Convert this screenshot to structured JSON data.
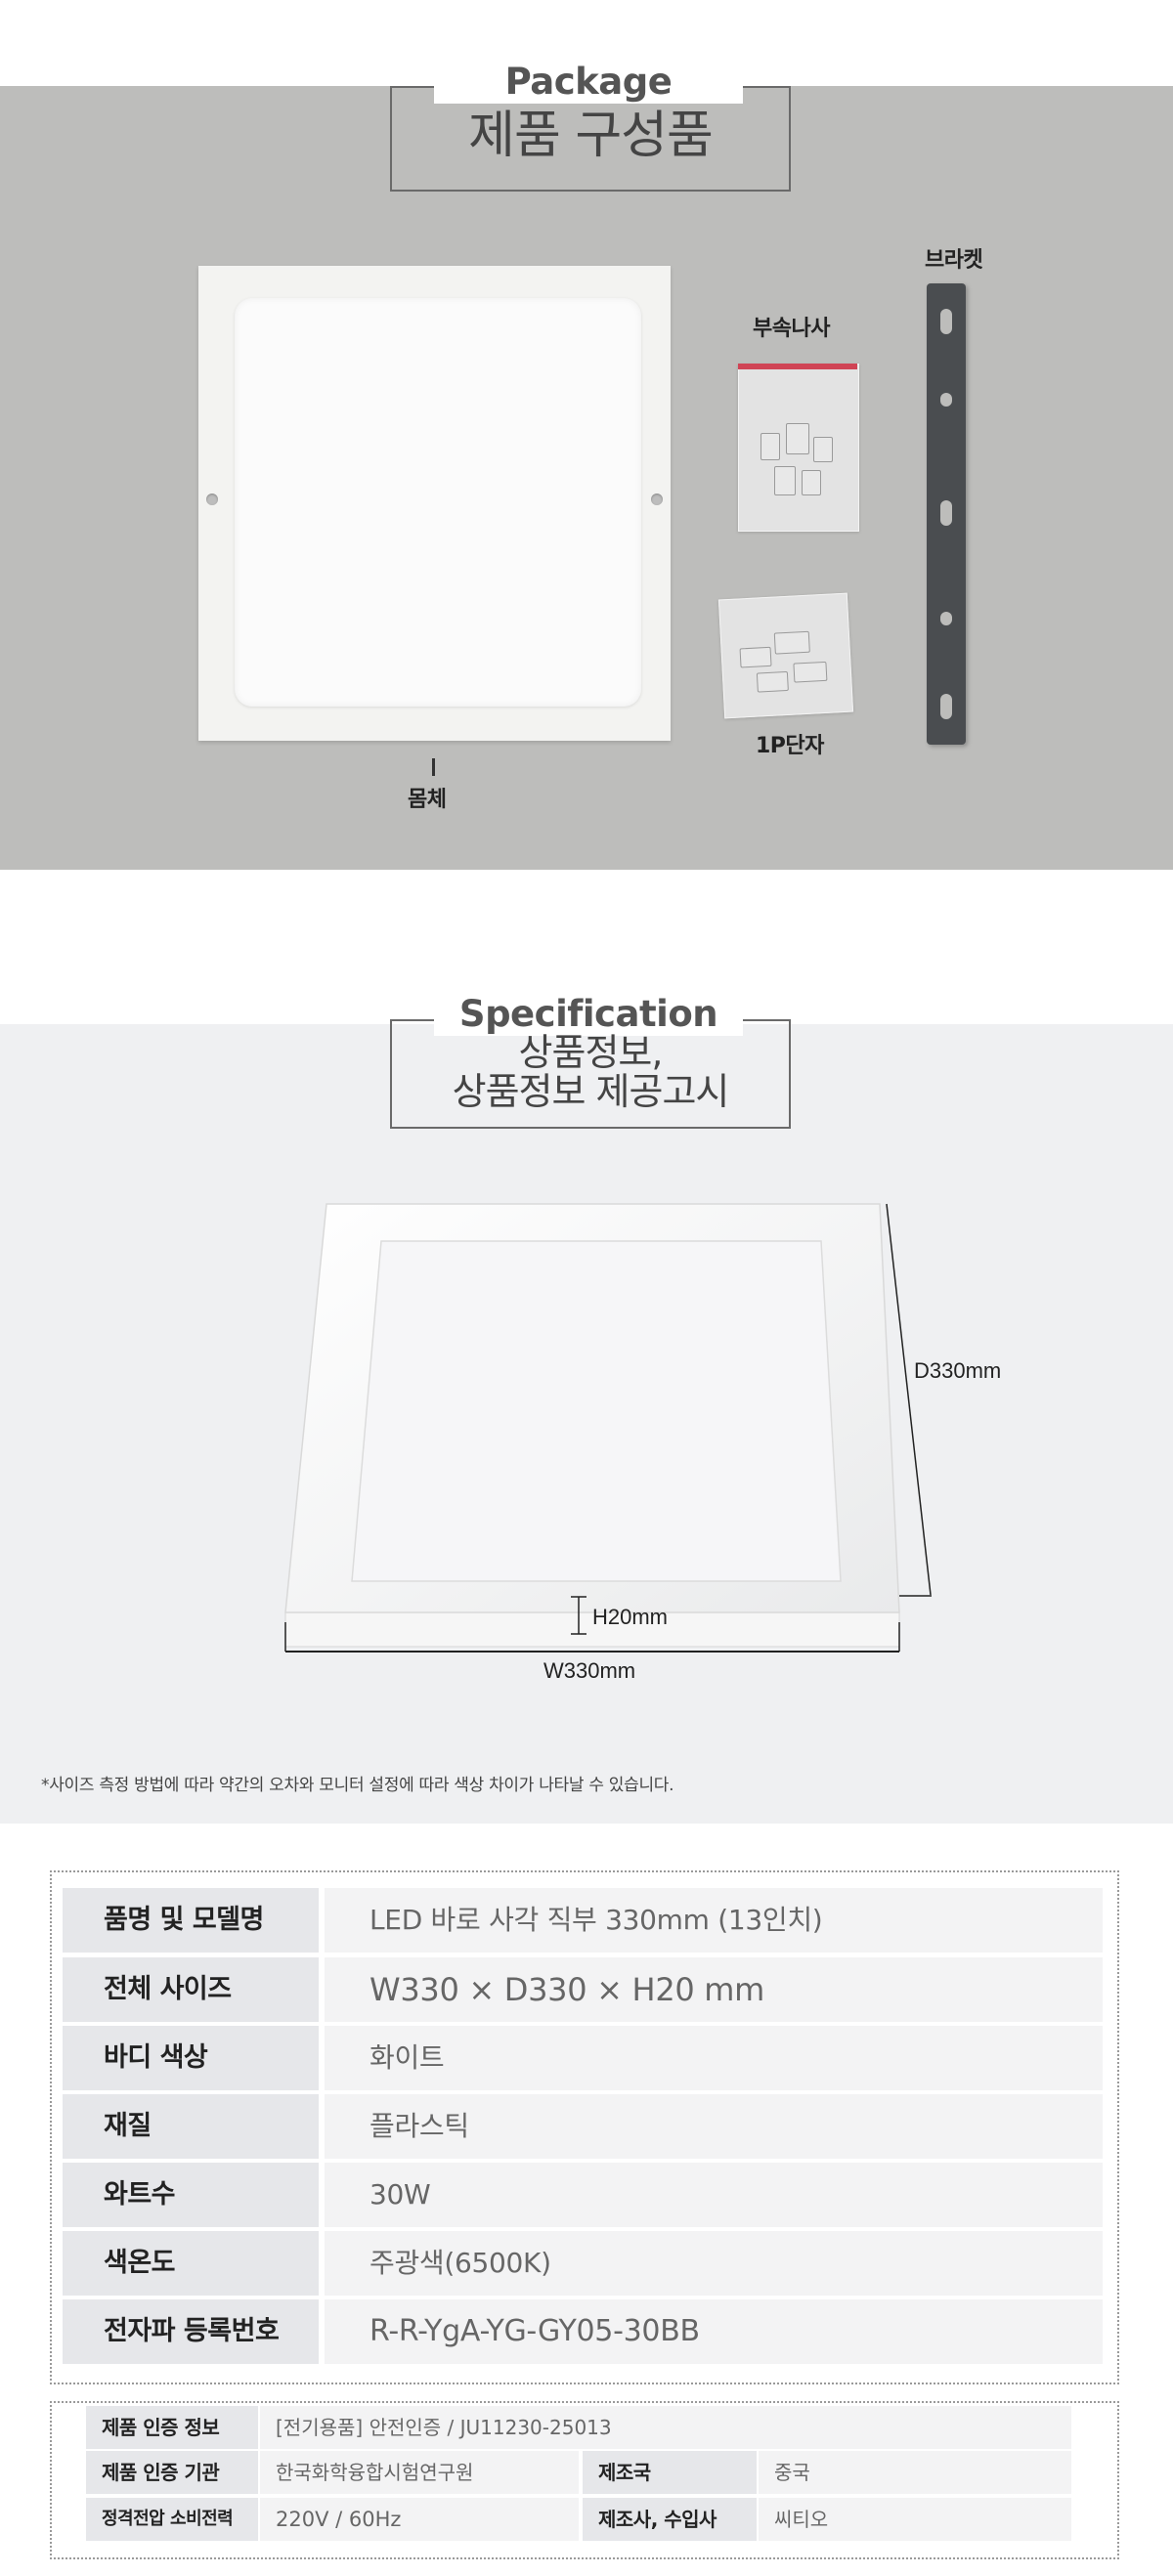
{
  "package": {
    "caption": "Package",
    "title": "제품 구성품",
    "labels": {
      "body": "몸체",
      "screws": "부속나사",
      "terminal": "1P단자",
      "bracket": "브라켓"
    }
  },
  "specification": {
    "caption": "Specification",
    "title_line1": "상품정보,",
    "title_line2": "상품정보 제공고시",
    "dimensions": {
      "depth": "D330mm",
      "height": "H20mm",
      "width": "W330mm"
    },
    "note": "*사이즈 측정 방법에 따라 약간의 오차와 모니터 설정에 따라 색상 차이가 나타날 수 있습니다."
  },
  "spec_table": [
    {
      "key": "품명 및 모델명",
      "value": "LED 바로 사각 직부 330mm (13인치)"
    },
    {
      "key": "전체 사이즈",
      "value": "W330 × D330 × H20 mm"
    },
    {
      "key": "바디 색상",
      "value": "화이트"
    },
    {
      "key": "재질",
      "value": "플라스틱"
    },
    {
      "key": "와트수",
      "value": "30W"
    },
    {
      "key": "색온도",
      "value": "주광색(6500K)"
    },
    {
      "key": "전자파 등록번호",
      "value": "R-R-YgA-YG-GY05-30BB"
    }
  ],
  "cert_table": {
    "cert_info_key": "제품 인증 정보",
    "cert_info_value": "[전기용품] 안전인증 / JU11230-25013",
    "cert_org_key": "제품 인증 기관",
    "cert_org_value": "한국화학융합시험연구원",
    "origin_key": "제조국",
    "origin_value": "중국",
    "power_key": "정격전압 소비전력",
    "power_value": "220V / 60Hz",
    "maker_key": "제조사, 수입사",
    "maker_value": "씨티오"
  }
}
